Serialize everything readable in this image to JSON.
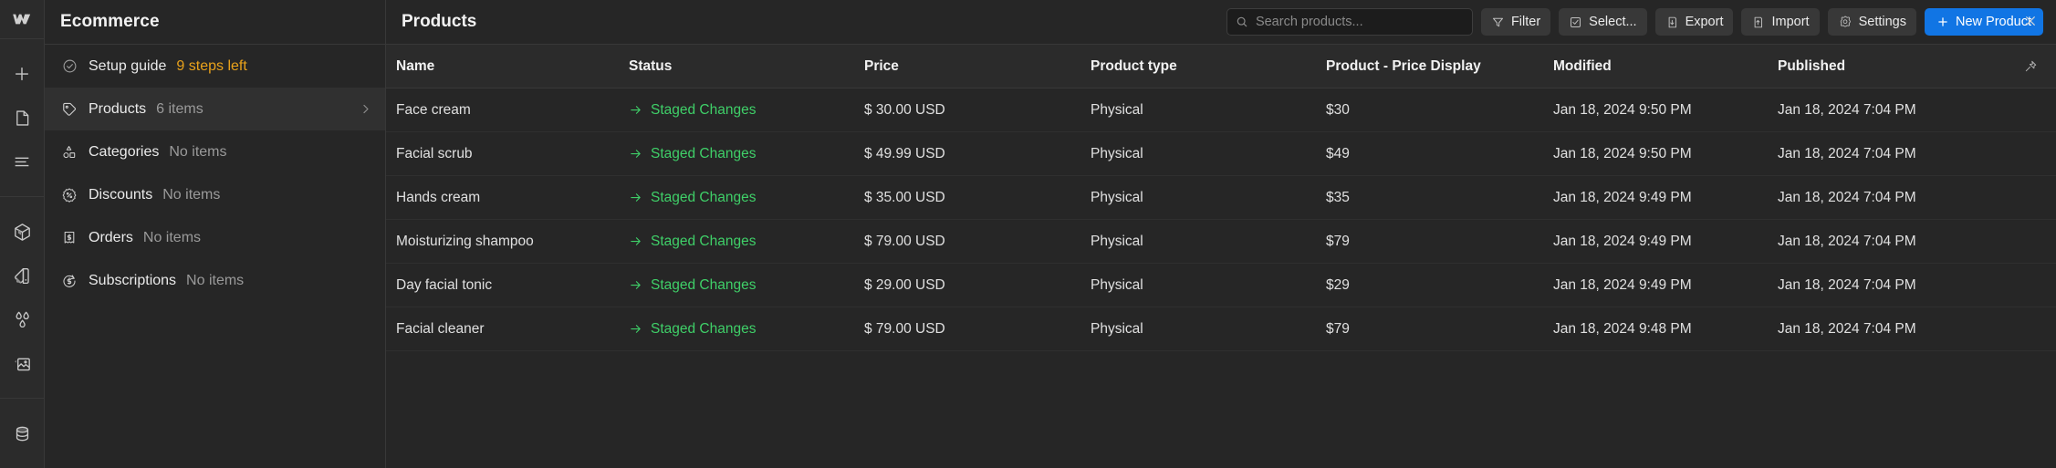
{
  "window": {
    "close_label": "close-icon"
  },
  "rail": {
    "logo": "webflow-logo",
    "items": [
      {
        "name": "add-icon"
      },
      {
        "name": "pages-icon"
      },
      {
        "name": "navigator-icon"
      },
      {
        "name": "components-icon"
      },
      {
        "name": "style-selectors-icon"
      },
      {
        "name": "variables-icon"
      },
      {
        "name": "assets-icon"
      },
      {
        "name": "cms-icon"
      }
    ]
  },
  "sidebar": {
    "title": "Ecommerce",
    "items": [
      {
        "label": "Setup guide",
        "meta": "9 steps left",
        "meta_style": "warn",
        "icon": "check-circle-icon",
        "active": false,
        "chevron": false
      },
      {
        "label": "Products",
        "meta": "6 items",
        "meta_style": "normal",
        "icon": "tag-icon",
        "active": true,
        "chevron": true
      },
      {
        "label": "Categories",
        "meta": "No items",
        "meta_style": "normal",
        "icon": "shapes-icon",
        "active": false,
        "chevron": false
      },
      {
        "label": "Discounts",
        "meta": "No items",
        "meta_style": "normal",
        "icon": "discount-badge-icon",
        "active": false,
        "chevron": false
      },
      {
        "label": "Orders",
        "meta": "No items",
        "meta_style": "normal",
        "icon": "receipt-icon",
        "active": false,
        "chevron": false
      },
      {
        "label": "Subscriptions",
        "meta": "No items",
        "meta_style": "normal",
        "icon": "recurring-dollar-icon",
        "active": false,
        "chevron": false
      }
    ]
  },
  "main": {
    "title": "Products",
    "search": {
      "value": "",
      "placeholder": "Search products..."
    },
    "buttons": {
      "filter": "Filter",
      "select": "Select...",
      "export": "Export",
      "import": "Import",
      "settings": "Settings",
      "new_product": "New Product"
    }
  },
  "table": {
    "columns": [
      "Name",
      "Status",
      "Price",
      "Product type",
      "Product - Price Display",
      "Modified",
      "Published"
    ],
    "pin_icon": "pin-icon",
    "status_arrow_icon": "arrow-right-icon",
    "rows": [
      {
        "name": "Face cream",
        "status": "Staged Changes",
        "price": "$ 30.00 USD",
        "ptype": "Physical",
        "pdisp": "$30",
        "modified": "Jan 18, 2024 9:50 PM",
        "published": "Jan 18, 2024 7:04 PM"
      },
      {
        "name": "Facial scrub",
        "status": "Staged Changes",
        "price": "$ 49.99 USD",
        "ptype": "Physical",
        "pdisp": "$49",
        "modified": "Jan 18, 2024 9:50 PM",
        "published": "Jan 18, 2024 7:04 PM"
      },
      {
        "name": "Hands cream",
        "status": "Staged Changes",
        "price": "$ 35.00 USD",
        "ptype": "Physical",
        "pdisp": "$35",
        "modified": "Jan 18, 2024 9:49 PM",
        "published": "Jan 18, 2024 7:04 PM"
      },
      {
        "name": "Moisturizing shampoo",
        "status": "Staged Changes",
        "price": "$ 79.00 USD",
        "ptype": "Physical",
        "pdisp": "$79",
        "modified": "Jan 18, 2024 9:49 PM",
        "published": "Jan 18, 2024 7:04 PM"
      },
      {
        "name": "Day facial tonic",
        "status": "Staged Changes",
        "price": "$ 29.00 USD",
        "ptype": "Physical",
        "pdisp": "$29",
        "modified": "Jan 18, 2024 9:49 PM",
        "published": "Jan 18, 2024 7:04 PM"
      },
      {
        "name": "Facial cleaner",
        "status": "Staged Changes",
        "price": "$ 79.00 USD",
        "ptype": "Physical",
        "pdisp": "$79",
        "modified": "Jan 18, 2024 9:48 PM",
        "published": "Jan 18, 2024 7:04 PM"
      }
    ]
  },
  "colors": {
    "accent": "#1175e4",
    "staged": "#3fcf68",
    "warning": "#e9a21b",
    "panel_bg": "#262626",
    "rail_bg": "#2b2b2b"
  }
}
